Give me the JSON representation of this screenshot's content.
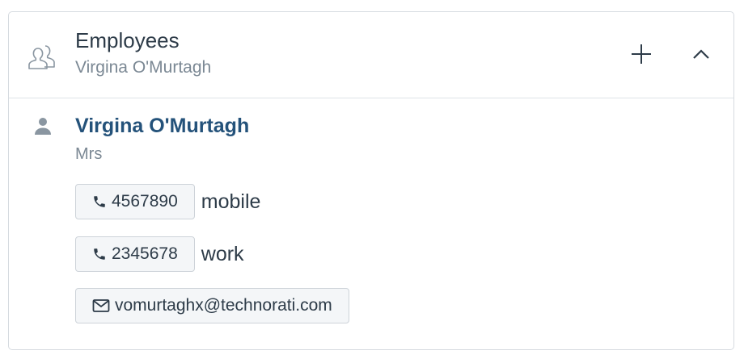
{
  "header": {
    "title": "Employees",
    "subtitle": "Virgina O'Murtagh"
  },
  "employee": {
    "name": "Virgina O'Murtagh",
    "salutation": "Mrs",
    "phones": [
      {
        "number": "4567890",
        "type": "mobile"
      },
      {
        "number": "2345678",
        "type": "work"
      }
    ],
    "email": "vomurtaghx@technorati.com"
  },
  "icons": {
    "header": "users-icon",
    "add": "plus-icon",
    "collapse": "chevron-up-icon",
    "person": "person-icon",
    "phone": "phone-icon",
    "email": "envelope-icon"
  },
  "colors": {
    "name_link": "#24527a",
    "muted_text": "#7b8894",
    "border": "#d6dbe0"
  }
}
